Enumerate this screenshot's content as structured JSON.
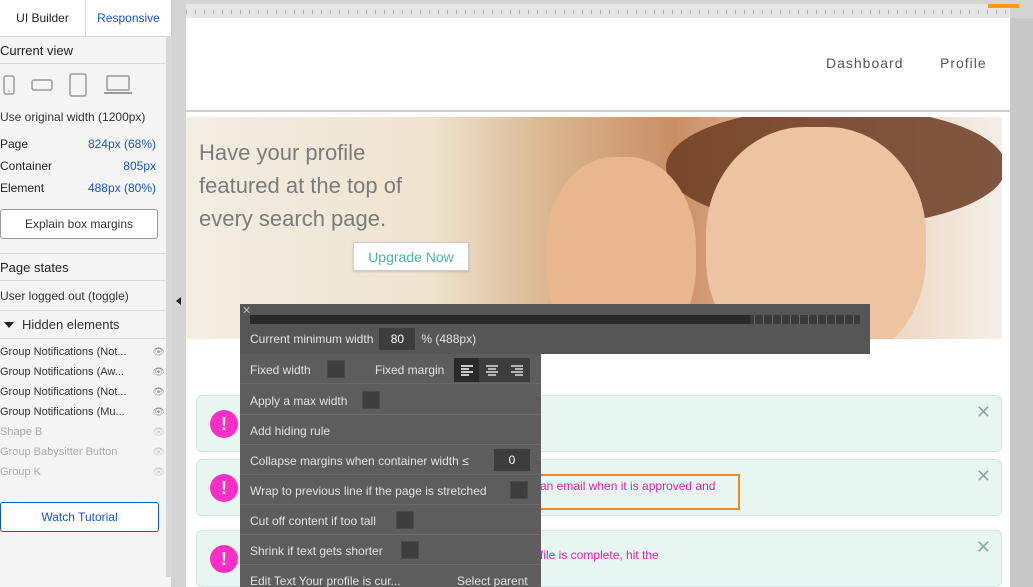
{
  "tabs": {
    "ui_builder": "UI Builder",
    "responsive": "Responsive"
  },
  "current_view": {
    "title": "Current view",
    "original_width": "Use original width (1200px)",
    "rows": [
      {
        "label": "Page",
        "value": "824px (68%)"
      },
      {
        "label": "Container",
        "value": "805px"
      },
      {
        "label": "Element",
        "value": "488px (80%)"
      }
    ],
    "explain_button": "Explain box margins"
  },
  "page_states": {
    "title": "Page states",
    "toggle": "User logged out (toggle)"
  },
  "hidden_elements": {
    "title": "Hidden elements",
    "items": [
      {
        "label": "Group Notifications (Not..."
      },
      {
        "label": "Group Notifications (Aw..."
      },
      {
        "label": "Group Notifications (Not..."
      },
      {
        "label": "Group Notifications (Mu..."
      },
      {
        "label": "Shape B"
      },
      {
        "label": "Group Babysitter Button"
      },
      {
        "label": "Group K"
      }
    ]
  },
  "watch_tutorial": "Watch Tutorial",
  "nav": {
    "dashboard": "Dashboard",
    "profile": "Profile"
  },
  "hero": {
    "text": "Have your profile featured at the top of every search page.",
    "button": "Upgrade Now"
  },
  "notifications": [
    {
      "text": ""
    },
    {
      "text": "an email when it is approved and"
    },
    {
      "text": "file is complete, hit the"
    }
  ],
  "popup": {
    "min_width_label": "Current minimum width",
    "min_width_value": "80",
    "min_width_suffix": "% (488px)",
    "min_width_fraction": 0.82,
    "fixed_width": "Fixed width",
    "fixed_margin": "Fixed margin",
    "max_width": "Apply a max width",
    "hiding_rule": "Add hiding rule",
    "collapse_margins": "Collapse margins when container width ≤",
    "collapse_value": "0",
    "wrap": "Wrap to previous line if the page is stretched",
    "cut_off": "Cut off content if too tall",
    "shrink": "Shrink if text gets shorter",
    "edit_text": "Edit Text Your profile is cur...",
    "select_parent": "Select parent"
  }
}
